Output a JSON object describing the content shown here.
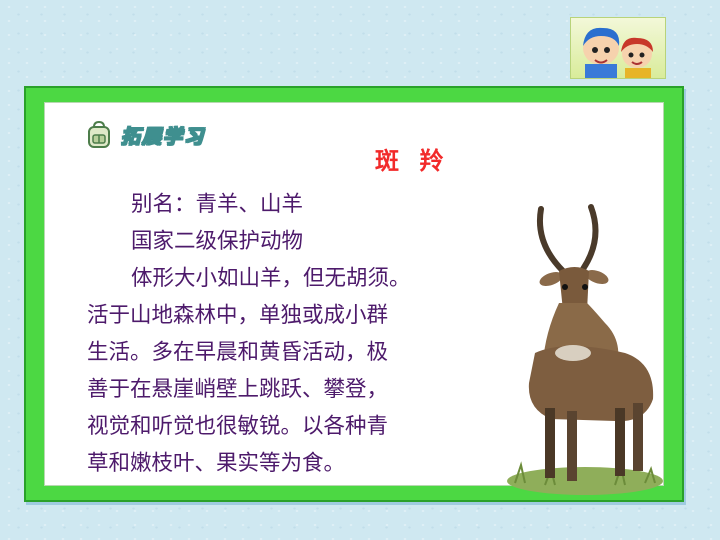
{
  "section": {
    "label": "拓展学习",
    "icon": "backpack-icon"
  },
  "title": "斑 羚",
  "paragraphs": [
    "别名：青羊、山羊",
    "国家二级保护动物",
    "体形大小如山羊，但无胡须。",
    "活于山地森林中，单独或成小群",
    "生活。多在早晨和黄昏活动，极",
    "善于在悬崖峭壁上跳跃、攀登，",
    "视觉和听觉也很敏锐。以各种青",
    "草和嫩枝叶、果实等为食。"
  ],
  "colors": {
    "frame": "#4cd843",
    "title": "#f22a2a",
    "text": "#4d1a6b",
    "background": "#cfe8f1"
  }
}
